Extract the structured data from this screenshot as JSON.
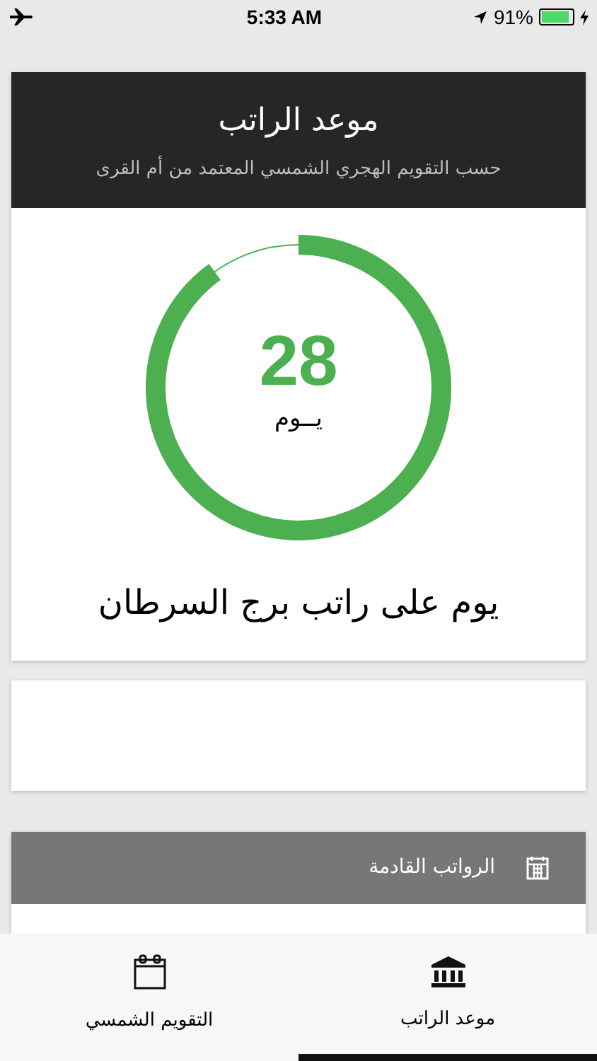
{
  "status_bar": {
    "time": "5:33 AM",
    "battery_percent": "91%",
    "battery": {
      "level": 0.91
    }
  },
  "header": {
    "title": "موعد الراتب",
    "subtitle": "حسب التقويم الهجري الشمسي المعتمد من أم القرى"
  },
  "countdown": {
    "level": 0.9,
    "number": "28",
    "unit": "يــوم",
    "caption": "يوم على راتب برج السرطان"
  },
  "upcoming": {
    "title": "الرواتب القادمة"
  },
  "tabs": [
    {
      "label": "موعد الراتب",
      "kind": "bank",
      "selected": true
    },
    {
      "label": "التقويم الشمسي",
      "kind": "calendar",
      "selected": false
    }
  ]
}
